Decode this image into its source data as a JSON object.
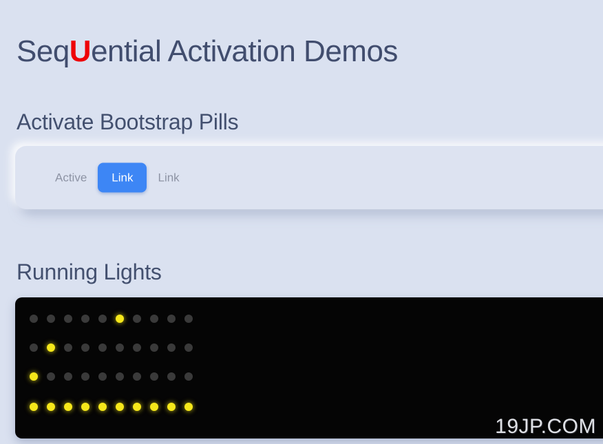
{
  "page": {
    "background_color": "#dae1f0",
    "watermark": "19JP.COM"
  },
  "title": {
    "before": "Seq",
    "accent": "U",
    "after": "ential Activation Demos",
    "accent_color": "#ee0007",
    "text_color": "#414d6e"
  },
  "sections": {
    "pills": {
      "heading": "Activate Bootstrap Pills",
      "card_color": "#dde3f1",
      "active_color": "#3d86f5",
      "items": [
        {
          "label": "Active",
          "active": false
        },
        {
          "label": "Link",
          "active": true
        },
        {
          "label": "Link",
          "active": false
        }
      ]
    },
    "lights": {
      "heading": "Running Lights",
      "panel_color": "#050505",
      "led_off_color": "#3a3a3a",
      "led_on_color": "#f5e71a",
      "columns": 10,
      "rows": [
        {
          "index": 0,
          "lit": [
            5
          ],
          "states": [
            0,
            0,
            0,
            0,
            0,
            1,
            0,
            0,
            0,
            0
          ]
        },
        {
          "index": 1,
          "lit": [
            1
          ],
          "states": [
            0,
            1,
            0,
            0,
            0,
            0,
            0,
            0,
            0,
            0
          ]
        },
        {
          "index": 2,
          "lit": [
            0
          ],
          "states": [
            1,
            0,
            0,
            0,
            0,
            0,
            0,
            0,
            0,
            0
          ]
        },
        {
          "index": 3,
          "lit": [
            0,
            1,
            2,
            3,
            4,
            5,
            6,
            7,
            8,
            9
          ],
          "states": [
            1,
            1,
            1,
            1,
            1,
            1,
            1,
            1,
            1,
            1
          ]
        }
      ]
    }
  }
}
